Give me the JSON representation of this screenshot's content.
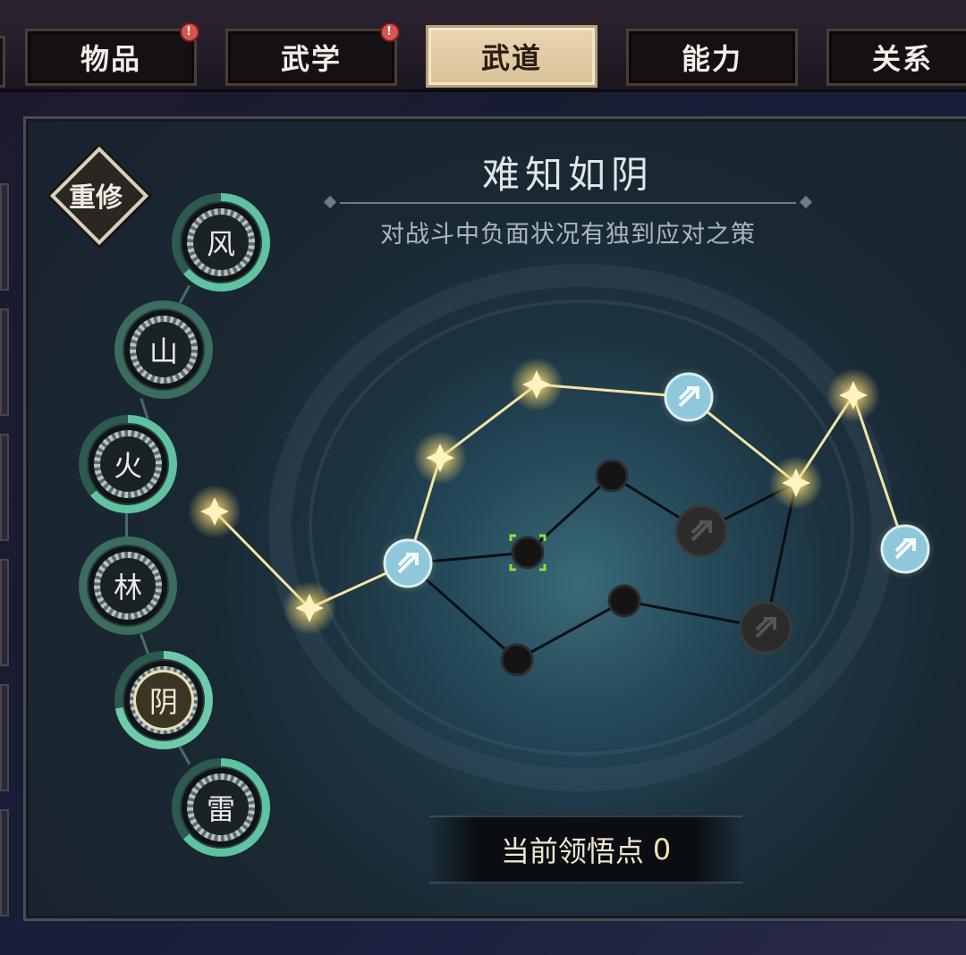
{
  "tabs": [
    {
      "label": "物品",
      "alert": "!"
    },
    {
      "label": "武学",
      "alert": "!"
    },
    {
      "label": "武道",
      "active": true
    },
    {
      "label": "能力"
    },
    {
      "label": "关系"
    }
  ],
  "reset_label": "重修",
  "skill": {
    "title": "难知如阴",
    "description": "对战斗中负面状况有独到应对之策"
  },
  "elements": [
    "风",
    "山",
    "火",
    "林",
    "阴",
    "雷"
  ],
  "points": {
    "label": "当前领悟点",
    "value": "0"
  },
  "icons": {
    "lit_node": "star-icon",
    "skill_node": "arrow-icon",
    "locked_node": "dark-dot-icon"
  },
  "colors": {
    "active_tab": "#e9d6b0",
    "lit_line": "#f3e3a6",
    "ring_green": "#5fc2a0",
    "skill_node": "#8ec8da"
  }
}
